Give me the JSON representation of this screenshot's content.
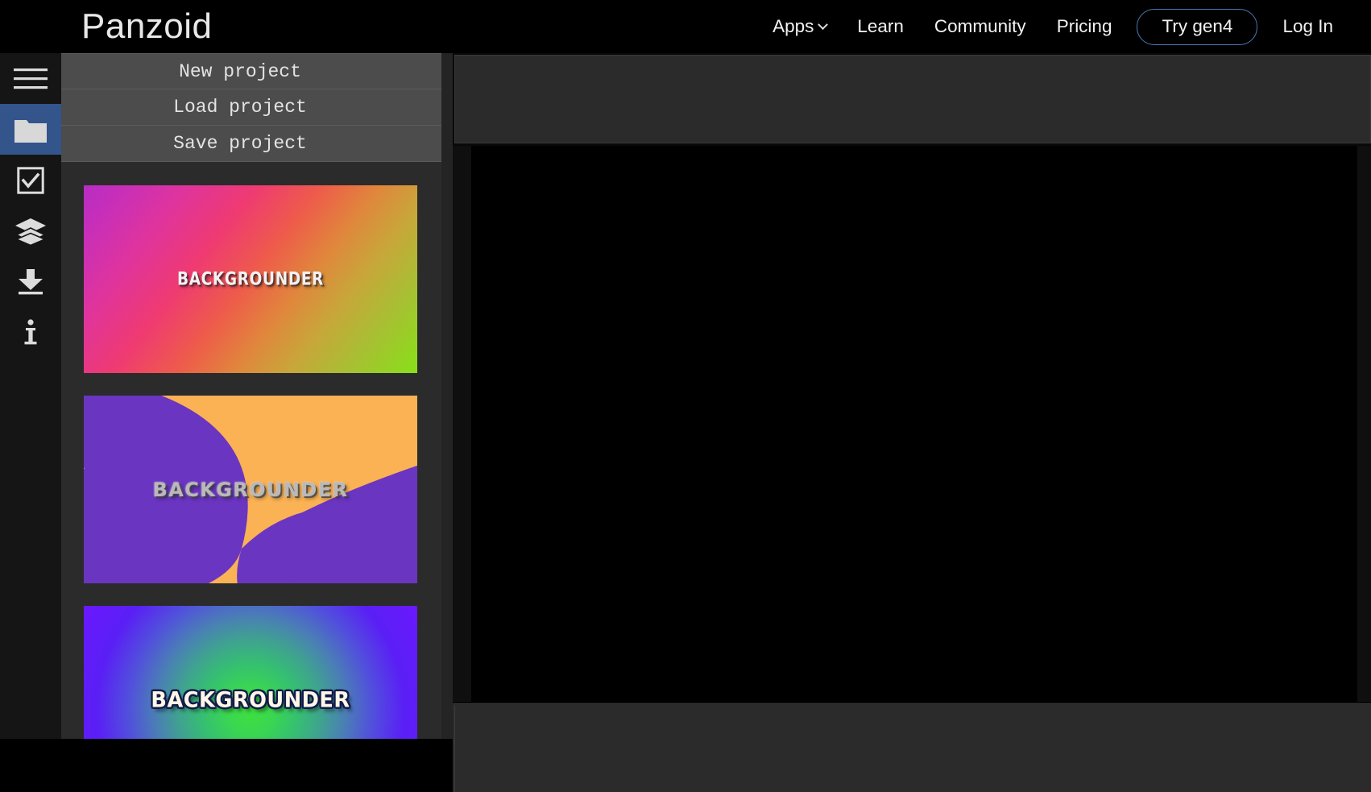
{
  "nav": {
    "brand": "Panzoid",
    "links": [
      {
        "label": "Apps",
        "icon": "chevron-down-icon",
        "has_chevron": true
      },
      {
        "label": "Learn",
        "has_chevron": false
      },
      {
        "label": "Community",
        "has_chevron": false
      },
      {
        "label": "Pricing",
        "has_chevron": false
      }
    ],
    "cta": {
      "label": "Try gen4",
      "border_color": "#4a79b5"
    },
    "login": {
      "label": "Log In"
    },
    "background": "#000000"
  },
  "sidebar": {
    "active_index": 1,
    "active_color": "#34548c",
    "background": "#151515",
    "items": [
      {
        "name": "menu",
        "icon": "hamburger-menu-icon",
        "active": false
      },
      {
        "name": "projects",
        "icon": "folder-icon",
        "active": true
      },
      {
        "name": "settings",
        "icon": "checkbox-icon",
        "active": false
      },
      {
        "name": "layers",
        "icon": "layers-icon",
        "active": false
      },
      {
        "name": "download",
        "icon": "download-icon",
        "active": false
      },
      {
        "name": "info",
        "icon": "info-icon",
        "active": false
      }
    ]
  },
  "project_panel": {
    "background": "#2b2b2b",
    "menu": [
      {
        "label": "New project"
      },
      {
        "label": "Load project"
      },
      {
        "label": "Save project"
      }
    ],
    "thumbnails": [
      {
        "caption": "BACKGROUNDER",
        "style": "linear-gradient",
        "colors": [
          "#b72cc4",
          "#e0349c",
          "#ef3a72",
          "#ee5c4a",
          "#e0873c",
          "#a8bf33",
          "#88e018"
        ],
        "text_color": "#f2f2f2"
      },
      {
        "caption": "BACKGROUNDER",
        "style": "spiral",
        "colors": [
          "#fbb254",
          "#6a35c0"
        ],
        "text_color": "#b9b9b9"
      },
      {
        "caption": "BACKGROUNDER",
        "style": "radial-gradient",
        "colors": [
          "#3ee03e",
          "#35c070",
          "#4a7fb5",
          "#5150dc",
          "#6b18ff"
        ],
        "text_color": "#fff8e6"
      }
    ],
    "scrollbar": {
      "track_color": "#242424",
      "thumb_color": "#6b6b6b"
    }
  },
  "workspace": {
    "toolbar_background": "#2b2b2b",
    "canvas_background": "#000000",
    "timeline_background": "#2b2b2b"
  }
}
